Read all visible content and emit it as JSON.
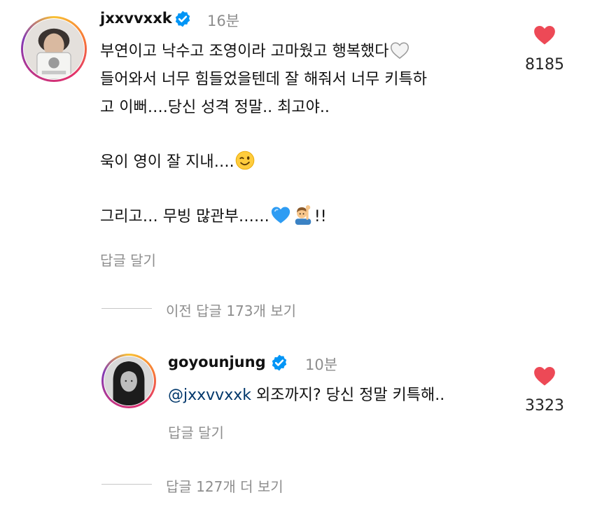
{
  "comment": {
    "username": "jxxvvxxk",
    "time": "16분",
    "lines": {
      "l1": "부연이고 낙수고 조영이라 고마웠고 행복했다",
      "l2": "들어와서 너무 힘들었을텐데 잘 해줘서 너무 키특하",
      "l3": "고 이뻐….당신 성격 정말.. 최고야..",
      "l4": "욱이 영이 잘 지내….",
      "l5a": "그리고… 무빙 많관부……",
      "l5b": "!!"
    },
    "reply_label": "답글 달기",
    "likes": "8185",
    "icons": {
      "l1_emoji": "white-heart-icon",
      "l4_emoji": "winking-face-icon",
      "l5_emoji_1": "blue-heart-icon",
      "l5_emoji_2": "person-raising-hand-icon",
      "verified": "verified-badge-icon",
      "like": "heart-icon"
    }
  },
  "view_previous": {
    "label": "이전 답글 173개 보기"
  },
  "reply": {
    "username": "goyounjung",
    "time": "10분",
    "mention": "@jxxvvxxk",
    "text": " 외조까지? 당신 정말 키특해..",
    "reply_label": "답글 달기",
    "likes": "3323"
  },
  "view_more": {
    "label": "답글 127개 더 보기"
  },
  "colors": {
    "like_red": "#ed4956",
    "verified_blue": "#0095f6",
    "secondary_text": "#8e8e8e",
    "mention_blue": "#00376b"
  }
}
